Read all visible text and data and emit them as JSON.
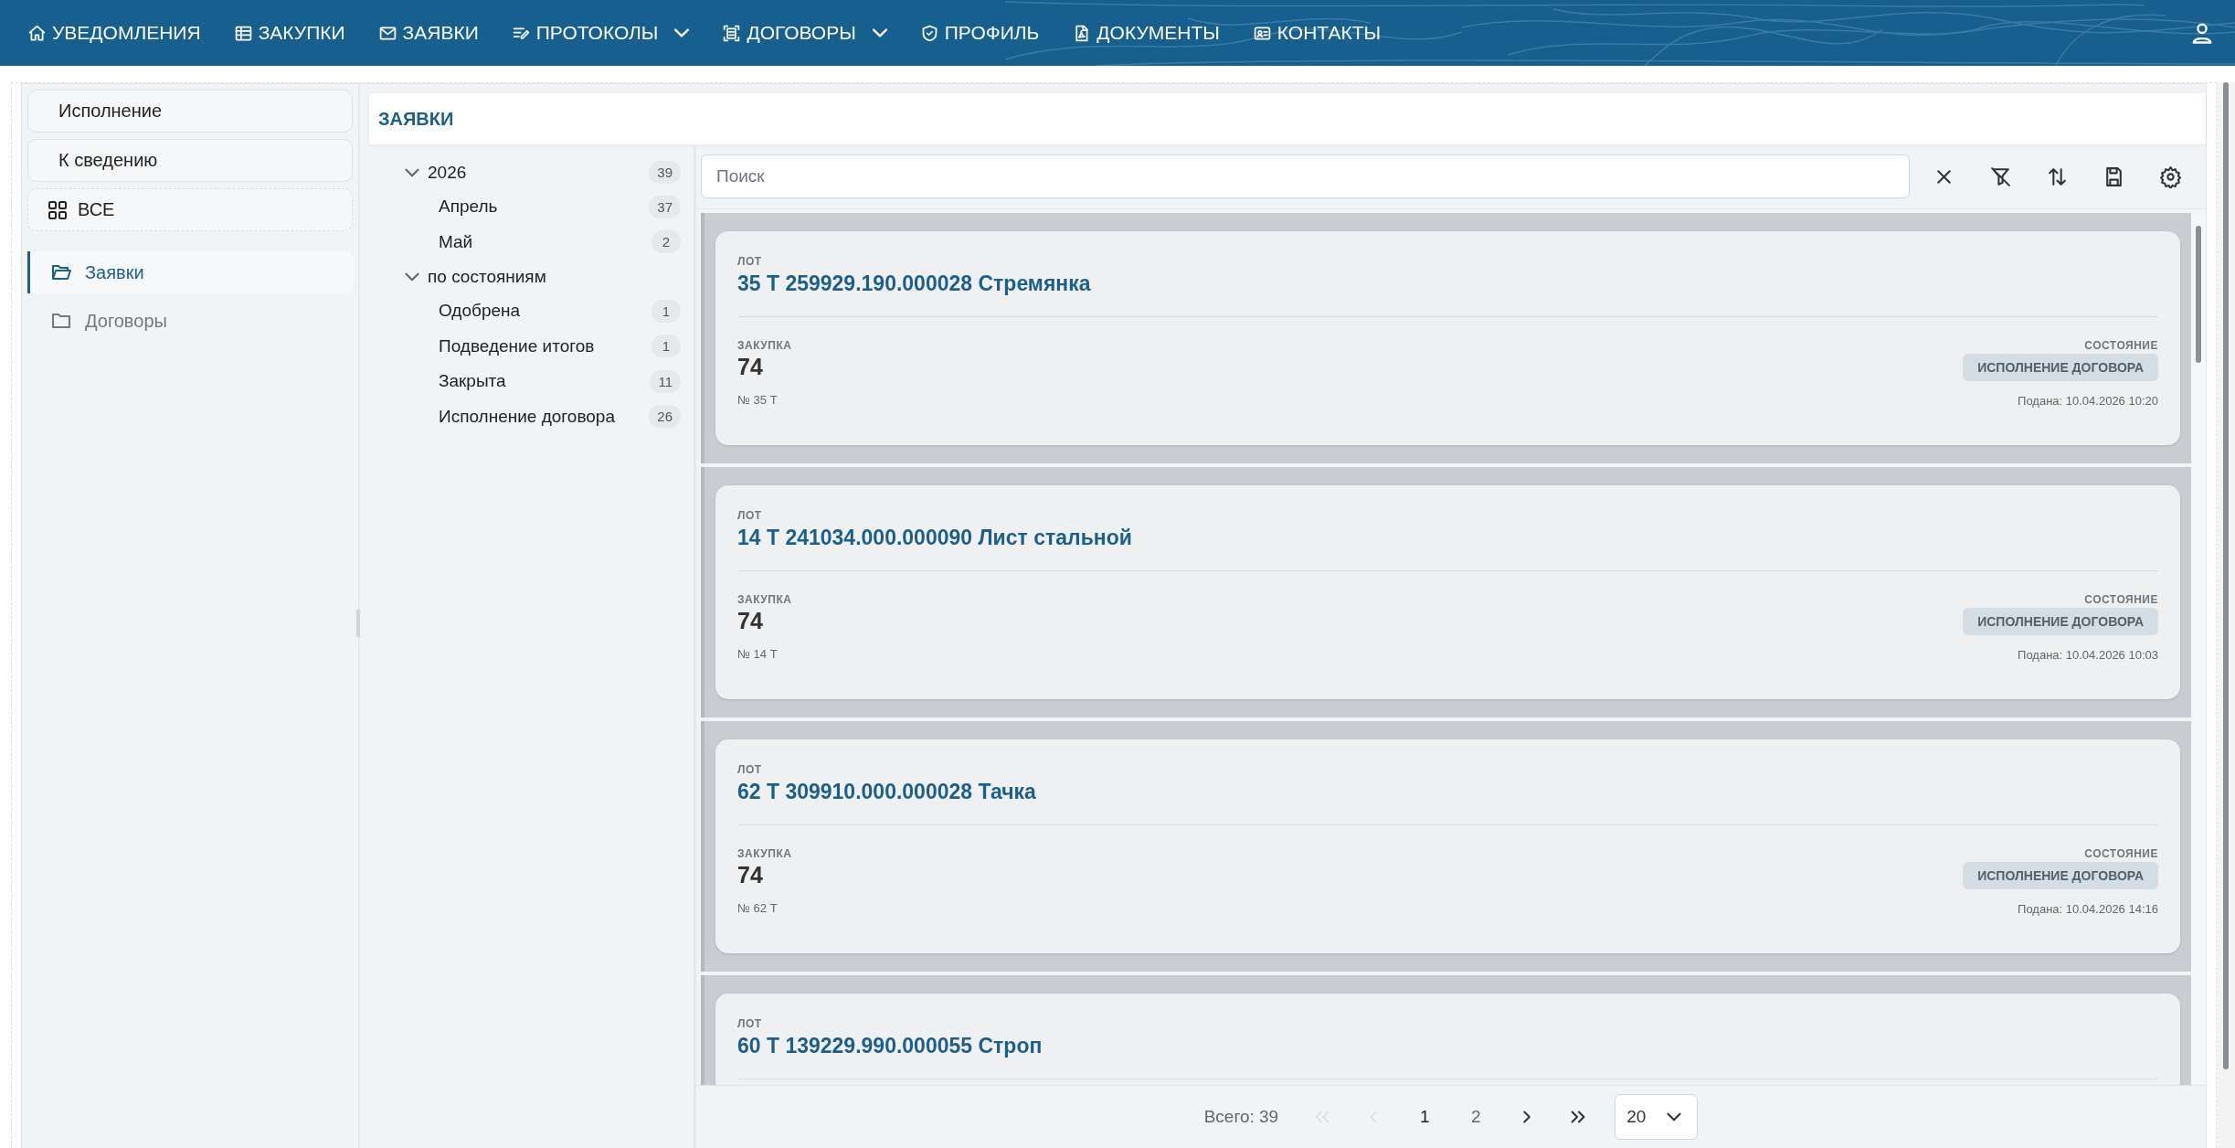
{
  "nav": {
    "items": [
      {
        "label": "УВЕДОМЛЕНИЯ",
        "has_menu": false
      },
      {
        "label": "ЗАКУПКИ",
        "has_menu": false
      },
      {
        "label": "ЗАЯВКИ",
        "has_menu": false
      },
      {
        "label": "ПРОТОКОЛЫ",
        "has_menu": true
      },
      {
        "label": "ДОГОВОРЫ",
        "has_menu": true
      },
      {
        "label": "ПРОФИЛЬ",
        "has_menu": false
      },
      {
        "label": "ДОКУМЕНТЫ",
        "has_menu": false
      },
      {
        "label": "КОНТАКТЫ",
        "has_menu": false
      }
    ]
  },
  "sidebar": {
    "buttons": [
      {
        "label": "Исполнение",
        "kind": "plain"
      },
      {
        "label": "К сведению",
        "kind": "plain"
      },
      {
        "label": "ВСЕ",
        "kind": "all"
      }
    ],
    "folders": [
      {
        "label": "Заявки",
        "selected": true
      },
      {
        "label": "Договоры",
        "selected": false
      }
    ]
  },
  "section_title": "ЗАЯВКИ",
  "tree": [
    {
      "label": "2026",
      "count": "39",
      "expanded": true,
      "children": [
        {
          "label": "Апрель",
          "count": "37"
        },
        {
          "label": "Май",
          "count": "2"
        }
      ]
    },
    {
      "label": "по состояниям",
      "expanded": true,
      "children": [
        {
          "label": "Одобрена",
          "count": "1"
        },
        {
          "label": "Подведение итогов",
          "count": "1"
        },
        {
          "label": "Закрыта",
          "count": "11"
        },
        {
          "label": "Исполнение договора",
          "count": "26"
        }
      ]
    }
  ],
  "search": {
    "placeholder": "Поиск"
  },
  "cards": [
    {
      "lot_label": "ЛОТ",
      "title": "35 Т 259929.190.000028 Стремянка",
      "purchase_label": "ЗАКУПКА",
      "purchase": "74",
      "number": "№ 35 Т",
      "status_label": "СОСТОЯНИЕ",
      "status": "ИСПОЛНЕНИЕ ДОГОВОРА",
      "submitted": "Подана: 10.04.2026 10:20"
    },
    {
      "lot_label": "ЛОТ",
      "title": "14 Т 241034.000.000090 Лист стальной",
      "purchase_label": "ЗАКУПКА",
      "purchase": "74",
      "number": "№ 14 Т",
      "status_label": "СОСТОЯНИЕ",
      "status": "ИСПОЛНЕНИЕ ДОГОВОРА",
      "submitted": "Подана: 10.04.2026 10:03"
    },
    {
      "lot_label": "ЛОТ",
      "title": "62 Т 309910.000.000028 Тачка",
      "purchase_label": "ЗАКУПКА",
      "purchase": "74",
      "number": "№ 62 Т",
      "status_label": "СОСТОЯНИЕ",
      "status": "ИСПОЛНЕНИЕ ДОГОВОРА",
      "submitted": "Подана: 10.04.2026 14:16"
    },
    {
      "lot_label": "ЛОТ",
      "title": "60 Т 139229.990.000055 Строп"
    }
  ],
  "pager": {
    "total": "Всего: 39",
    "nav_buttons": [
      {
        "kind": "first",
        "disabled": true
      },
      {
        "kind": "prev",
        "disabled": true
      },
      {
        "kind": "next",
        "disabled": false
      },
      {
        "kind": "last",
        "disabled": false
      }
    ],
    "pages": [
      {
        "label": "1",
        "selected": true
      },
      {
        "label": "2",
        "selected": false
      }
    ],
    "page_size": "20"
  }
}
